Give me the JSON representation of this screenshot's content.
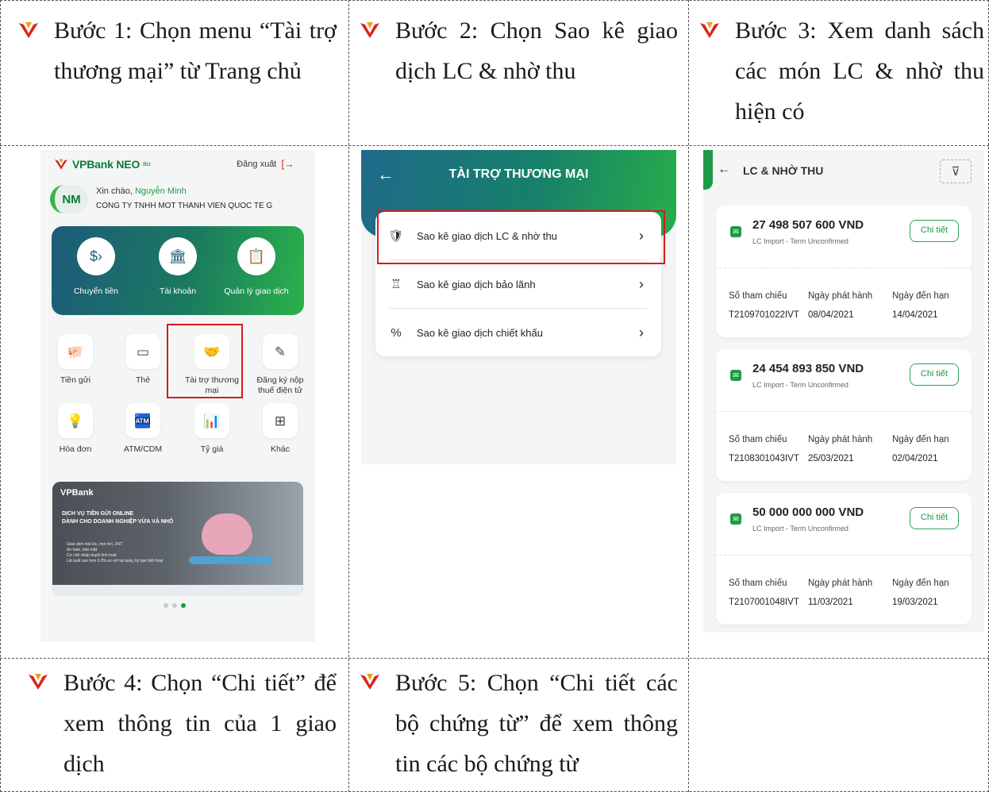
{
  "steps": {
    "step1": "Bước 1: Chọn menu “Tài trợ thương mại” từ Trang chủ",
    "step2": "Bước 2: Chọn Sao kê giao dịch LC & nhờ thu",
    "step3": "Bước 3: Xem danh sách các món LC & nhờ thu hiện có",
    "step4": "Bước 4: Chọn “Chi tiết” để xem thông tin của 1 giao dịch",
    "step5": "Bước 5: Chọn “Chi tiết các bộ chứng từ” để xem thông tin các bộ chứng từ"
  },
  "screen1": {
    "brand": "VPBank NEO",
    "brand_sup": "Biz",
    "logout": "Đăng xuất",
    "avatar": "NM",
    "greeting": "Xin chào,",
    "user_name": "Nguyễn Minh",
    "company": "CONG TY TNHH MOT THANH VIEN QUOC TE G",
    "quick": [
      "Chuyển tiền",
      "Tài khoản",
      "Quản lý giao dịch"
    ],
    "tiles": [
      {
        "label": "Tiền gửi"
      },
      {
        "label": "Thẻ"
      },
      {
        "label": "Tài trợ thương mại"
      },
      {
        "label": "Đăng ký nộp thuế điện tử"
      },
      {
        "label": "Hóa đơn"
      },
      {
        "label": "ATM/CDM"
      },
      {
        "label": "Tỷ giá"
      },
      {
        "label": "Khác"
      }
    ],
    "banner_logo": "VPBank",
    "banner_title_1": "DỊCH VỤ TIỀN GỬI ONLINE",
    "banner_title_2": "DÀNH CHO DOANH NGHIỆP VỪA VÀ NHỎ",
    "banner_points": [
      "Giao dịch mọi lúc, mọi nơi, 24/7",
      "An toàn, bảo mật",
      "Cơ chế nhập duyệt linh hoạt",
      "Lãi suất cao hơn 0.2% so với tại quầy, kỳ hạn linh hoạt"
    ]
  },
  "screen2": {
    "title": "TÀI TRỢ THƯƠNG MẠI",
    "items": [
      "Sao kê giao dịch LC & nhờ thu",
      "Sao kê giao dịch bảo lãnh",
      "Sao kê giao dịch chiết khấu"
    ]
  },
  "screen3": {
    "title": "LC & NHỜ THU",
    "detail_label": "Chi tiết",
    "col_ref": "Số tham chiếu",
    "col_issue": "Ngày phát hành",
    "col_due": "Ngày đến hạn",
    "records": [
      {
        "amount": "27 498 507 600 VND",
        "status": "LC Import - Term Unconfirmed",
        "ref": "T2109701022IVT",
        "issue": "08/04/2021",
        "due": "14/04/2021"
      },
      {
        "amount": "24 454 893 850 VND",
        "status": "LC Import - Term Unconfirmed",
        "ref": "T2108301043IVT",
        "issue": "25/03/2021",
        "due": "02/04/2021"
      },
      {
        "amount": "50 000 000 000 VND",
        "status": "LC Import - Term Unconfirmed",
        "ref": "T2107001048IVT",
        "issue": "11/03/2021",
        "due": "19/03/2021"
      }
    ]
  }
}
